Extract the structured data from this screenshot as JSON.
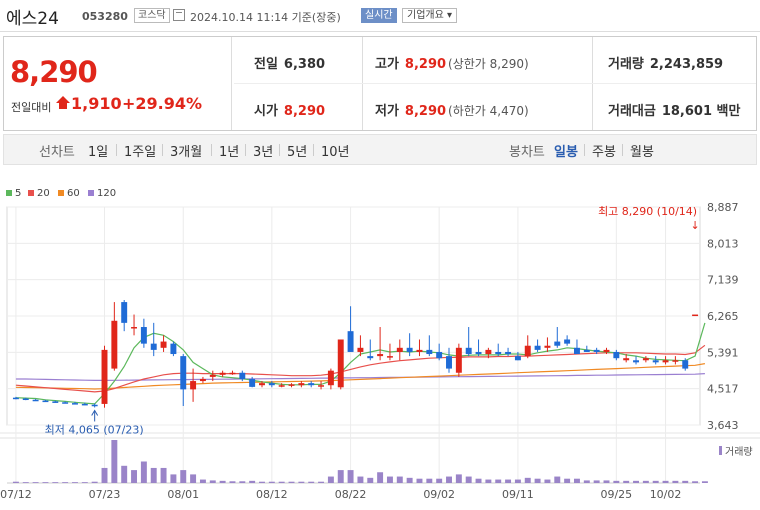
{
  "stock": {
    "name": "에스24",
    "code": "053280",
    "market": "코스닥",
    "timestamp": "2024.10.14 11:14 기준(장중)",
    "realtime_label": "실시간",
    "overview_label": "기업개요 ▾"
  },
  "quote": {
    "price": "8,290",
    "change_label": "전일대비",
    "change": "1,910",
    "change_pct": "+29.94%"
  },
  "stats": {
    "prev_close": {
      "label": "전일",
      "value": "6,380"
    },
    "high": {
      "label": "고가",
      "value": "8,290",
      "sub": "(상한가 8,290)"
    },
    "volume": {
      "label": "거래량",
      "value": "2,243,859"
    },
    "open": {
      "label": "시가",
      "value": "8,290"
    },
    "low": {
      "label": "저가",
      "value": "8,290",
      "sub": "(하한가 4,470)"
    },
    "trade_value": {
      "label": "거래대금",
      "value": "18,601 백만"
    }
  },
  "toolbar": {
    "line_label": "선차트",
    "periods": [
      "1일",
      "1주일",
      "3개월",
      "1년",
      "3년",
      "5년",
      "10년"
    ],
    "candle_label": "봉차트",
    "candle_periods": [
      "일봉",
      "주봉",
      "월봉"
    ],
    "active": "일봉"
  },
  "colors": {
    "up": "#e0261a",
    "down": "#1f6bd6",
    "ma5": "#5cb85c",
    "ma20": "#e8504c",
    "ma60": "#f08a24",
    "ma120": "#9a7fd1",
    "volume": "#9a84c8"
  },
  "chart_data": {
    "type": "candlestick",
    "legend": [
      "5",
      "20",
      "60",
      "120"
    ],
    "y_ticks": [
      "8,887",
      "8,013",
      "7,139",
      "6,265",
      "5,391",
      "4,517",
      "3,643"
    ],
    "ylim": [
      3643,
      8887
    ],
    "x_ticks": [
      "07/12",
      "07/23",
      "08/01",
      "08/12",
      "08/22",
      "09/02",
      "09/11",
      "09/25",
      "10/02"
    ],
    "max_label": "최고 8,290 (10/14)",
    "min_label": "최저 4,065 (07/23)",
    "volume_label": "거래량",
    "candles": [
      {
        "o": 4300,
        "h": 4320,
        "l": 4260,
        "c": 4280
      },
      {
        "o": 4280,
        "h": 4300,
        "l": 4240,
        "c": 4250
      },
      {
        "o": 4250,
        "h": 4270,
        "l": 4220,
        "c": 4230
      },
      {
        "o": 4230,
        "h": 4250,
        "l": 4200,
        "c": 4210
      },
      {
        "o": 4210,
        "h": 4230,
        "l": 4180,
        "c": 4190
      },
      {
        "o": 4190,
        "h": 4210,
        "l": 4160,
        "c": 4170
      },
      {
        "o": 4170,
        "h": 4200,
        "l": 4140,
        "c": 4150
      },
      {
        "o": 4150,
        "h": 4180,
        "l": 4120,
        "c": 4130
      },
      {
        "o": 4130,
        "h": 4160,
        "l": 4065,
        "c": 4120
      },
      {
        "o": 4150,
        "h": 5550,
        "l": 4060,
        "c": 5450
      },
      {
        "o": 5000,
        "h": 6600,
        "l": 4950,
        "c": 6150
      },
      {
        "o": 6600,
        "h": 6650,
        "l": 5900,
        "c": 6100
      },
      {
        "o": 6000,
        "h": 6300,
        "l": 5800,
        "c": 6000
      },
      {
        "o": 6000,
        "h": 6200,
        "l": 5500,
        "c": 5600
      },
      {
        "o": 5600,
        "h": 6100,
        "l": 5300,
        "c": 5450
      },
      {
        "o": 5500,
        "h": 5800,
        "l": 5400,
        "c": 5650
      },
      {
        "o": 5600,
        "h": 5650,
        "l": 5300,
        "c": 5350
      },
      {
        "o": 5300,
        "h": 5350,
        "l": 4100,
        "c": 4500
      },
      {
        "o": 4500,
        "h": 5000,
        "l": 4200,
        "c": 4700
      },
      {
        "o": 4700,
        "h": 4800,
        "l": 4650,
        "c": 4750
      },
      {
        "o": 4800,
        "h": 4950,
        "l": 4700,
        "c": 4850
      },
      {
        "o": 4850,
        "h": 4950,
        "l": 4800,
        "c": 4900
      },
      {
        "o": 4900,
        "h": 4950,
        "l": 4850,
        "c": 4900
      },
      {
        "o": 4900,
        "h": 4950,
        "l": 4700,
        "c": 4750
      },
      {
        "o": 4750,
        "h": 4800,
        "l": 4550,
        "c": 4560
      },
      {
        "o": 4600,
        "h": 4700,
        "l": 4550,
        "c": 4650
      },
      {
        "o": 4650,
        "h": 4700,
        "l": 4550,
        "c": 4600
      },
      {
        "o": 4600,
        "h": 4650,
        "l": 4550,
        "c": 4600
      },
      {
        "o": 4600,
        "h": 4650,
        "l": 4550,
        "c": 4620
      },
      {
        "o": 4600,
        "h": 4700,
        "l": 4550,
        "c": 4650
      },
      {
        "o": 4650,
        "h": 4700,
        "l": 4550,
        "c": 4600
      },
      {
        "o": 4600,
        "h": 4700,
        "l": 4500,
        "c": 4600
      },
      {
        "o": 4600,
        "h": 5000,
        "l": 4500,
        "c": 4950
      },
      {
        "o": 4550,
        "h": 5700,
        "l": 4500,
        "c": 5700
      },
      {
        "o": 5900,
        "h": 6500,
        "l": 5400,
        "c": 5400
      },
      {
        "o": 5400,
        "h": 5800,
        "l": 5300,
        "c": 5500
      },
      {
        "o": 5300,
        "h": 5700,
        "l": 5200,
        "c": 5250
      },
      {
        "o": 5300,
        "h": 6000,
        "l": 5200,
        "c": 5350
      },
      {
        "o": 5300,
        "h": 5600,
        "l": 5200,
        "c": 5300
      },
      {
        "o": 5400,
        "h": 5700,
        "l": 5200,
        "c": 5500
      },
      {
        "o": 5500,
        "h": 5850,
        "l": 5300,
        "c": 5400
      },
      {
        "o": 5400,
        "h": 5700,
        "l": 5300,
        "c": 5450
      },
      {
        "o": 5450,
        "h": 5800,
        "l": 5300,
        "c": 5350
      },
      {
        "o": 5400,
        "h": 5600,
        "l": 5200,
        "c": 5250
      },
      {
        "o": 5300,
        "h": 5500,
        "l": 4900,
        "c": 5000
      },
      {
        "o": 4900,
        "h": 5600,
        "l": 4800,
        "c": 5500
      },
      {
        "o": 5500,
        "h": 6000,
        "l": 5300,
        "c": 5350
      },
      {
        "o": 5400,
        "h": 5700,
        "l": 5300,
        "c": 5350
      },
      {
        "o": 5350,
        "h": 5500,
        "l": 5250,
        "c": 5450
      },
      {
        "o": 5400,
        "h": 5600,
        "l": 5300,
        "c": 5350
      },
      {
        "o": 5400,
        "h": 5500,
        "l": 5300,
        "c": 5350
      },
      {
        "o": 5300,
        "h": 5400,
        "l": 5200,
        "c": 5200
      },
      {
        "o": 5300,
        "h": 5800,
        "l": 5250,
        "c": 5550
      },
      {
        "o": 5550,
        "h": 5700,
        "l": 5400,
        "c": 5450
      },
      {
        "o": 5500,
        "h": 5750,
        "l": 5400,
        "c": 5550
      },
      {
        "o": 5650,
        "h": 6000,
        "l": 5500,
        "c": 5550
      },
      {
        "o": 5700,
        "h": 5800,
        "l": 5550,
        "c": 5600
      },
      {
        "o": 5500,
        "h": 5700,
        "l": 5350,
        "c": 5350
      },
      {
        "o": 5450,
        "h": 5550,
        "l": 5400,
        "c": 5400
      },
      {
        "o": 5450,
        "h": 5500,
        "l": 5350,
        "c": 5400
      },
      {
        "o": 5400,
        "h": 5500,
        "l": 5350,
        "c": 5450
      },
      {
        "o": 5400,
        "h": 5450,
        "l": 5200,
        "c": 5250
      },
      {
        "o": 5200,
        "h": 5350,
        "l": 5150,
        "c": 5250
      },
      {
        "o": 5200,
        "h": 5300,
        "l": 5100,
        "c": 5150
      },
      {
        "o": 5200,
        "h": 5300,
        "l": 5150,
        "c": 5250
      },
      {
        "o": 5200,
        "h": 5300,
        "l": 5100,
        "c": 5150
      },
      {
        "o": 5150,
        "h": 5300,
        "l": 5100,
        "c": 5200
      },
      {
        "o": 5200,
        "h": 5300,
        "l": 5100,
        "c": 5200
      },
      {
        "o": 5200,
        "h": 5250,
        "l": 4950,
        "c": 5000
      },
      {
        "o": 6300,
        "h": 6300,
        "l": 6300,
        "c": 6300
      }
    ],
    "volume_max": 10,
    "volumes": [
      0.3,
      0.2,
      0.2,
      0.2,
      0.2,
      0.2,
      0.2,
      0.2,
      0.3,
      3.5,
      10,
      4,
      3,
      5,
      3.5,
      3.5,
      2,
      3,
      2,
      0.8,
      0.6,
      0.5,
      0.4,
      0.4,
      0.5,
      0.3,
      0.3,
      0.3,
      0.3,
      0.3,
      0.3,
      0.3,
      1.5,
      3,
      3,
      1.5,
      1.2,
      2.5,
      1.5,
      1.5,
      1.2,
      1,
      1,
      1,
      1.5,
      2,
      1.5,
      1,
      0.8,
      0.8,
      0.8,
      0.8,
      1.2,
      1,
      0.8,
      1.5,
      1,
      1,
      0.6,
      0.6,
      0.6,
      0.5,
      0.5,
      0.5,
      0.5,
      0.5,
      0.5,
      0.5,
      0.5,
      0.4,
      0.4
    ],
    "ma5": [
      4300,
      4290,
      4280,
      4250,
      4230,
      4210,
      4190,
      4170,
      4150,
      4400,
      4700,
      5050,
      5500,
      5750,
      5850,
      5800,
      5650,
      5450,
      5150,
      5000,
      4850,
      4800,
      4780,
      4760,
      4720,
      4680,
      4650,
      4620,
      4610,
      4610,
      4620,
      4620,
      4700,
      4900,
      5150,
      5350,
      5400,
      5450,
      5400,
      5420,
      5400,
      5420,
      5400,
      5380,
      5330,
      5300,
      5320,
      5330,
      5330,
      5330,
      5350,
      5350,
      5330,
      5380,
      5420,
      5450,
      5500,
      5480,
      5450,
      5420,
      5400,
      5380,
      5330,
      5300,
      5250,
      5220,
      5210,
      5200,
      5190,
      5300,
      6100
    ],
    "ma20": [
      4600,
      4580,
      4560,
      4540,
      4520,
      4500,
      4480,
      4460,
      4440,
      4460,
      4520,
      4600,
      4680,
      4750,
      4800,
      4850,
      4880,
      4890,
      4890,
      4880,
      4880,
      4880,
      4880,
      4880,
      4870,
      4860,
      4850,
      4840,
      4830,
      4830,
      4830,
      4840,
      4870,
      4920,
      4980,
      5040,
      5090,
      5130,
      5160,
      5190,
      5210,
      5230,
      5250,
      5260,
      5270,
      5270,
      5280,
      5280,
      5280,
      5290,
      5290,
      5300,
      5300,
      5310,
      5320,
      5330,
      5340,
      5350,
      5360,
      5370,
      5380,
      5380,
      5380,
      5380,
      5370,
      5360,
      5350,
      5350,
      5340,
      5380,
      5560
    ],
    "ma60": [
      4550,
      4545,
      4540,
      4535,
      4530,
      4525,
      4520,
      4515,
      4510,
      4515,
      4530,
      4545,
      4560,
      4575,
      4590,
      4600,
      4610,
      4620,
      4630,
      4640,
      4650,
      4655,
      4660,
      4665,
      4670,
      4675,
      4680,
      4685,
      4690,
      4695,
      4700,
      4705,
      4710,
      4720,
      4730,
      4740,
      4750,
      4760,
      4770,
      4780,
      4790,
      4800,
      4810,
      4820,
      4830,
      4840,
      4850,
      4860,
      4870,
      4880,
      4890,
      4900,
      4910,
      4920,
      4930,
      4940,
      4950,
      4960,
      4970,
      4980,
      4990,
      5000,
      5010,
      5020,
      5030,
      5040,
      5050,
      5060,
      5070,
      5080,
      5120
    ],
    "ma120": [
      4750,
      4750,
      4745,
      4740,
      4735,
      4730,
      4725,
      4720,
      4715,
      4715,
      4718,
      4720,
      4722,
      4725,
      4728,
      4730,
      4732,
      4735,
      4737,
      4740,
      4742,
      4745,
      4747,
      4750,
      4752,
      4755,
      4757,
      4760,
      4762,
      4765,
      4767,
      4770,
      4772,
      4775,
      4777,
      4780,
      4782,
      4785,
      4787,
      4790,
      4792,
      4795,
      4797,
      4800,
      4802,
      4805,
      4807,
      4810,
      4812,
      4815,
      4817,
      4820,
      4822,
      4825,
      4827,
      4830,
      4832,
      4835,
      4837,
      4840,
      4842,
      4845,
      4847,
      4850,
      4852,
      4855,
      4857,
      4860,
      4862,
      4865,
      4880
    ]
  }
}
